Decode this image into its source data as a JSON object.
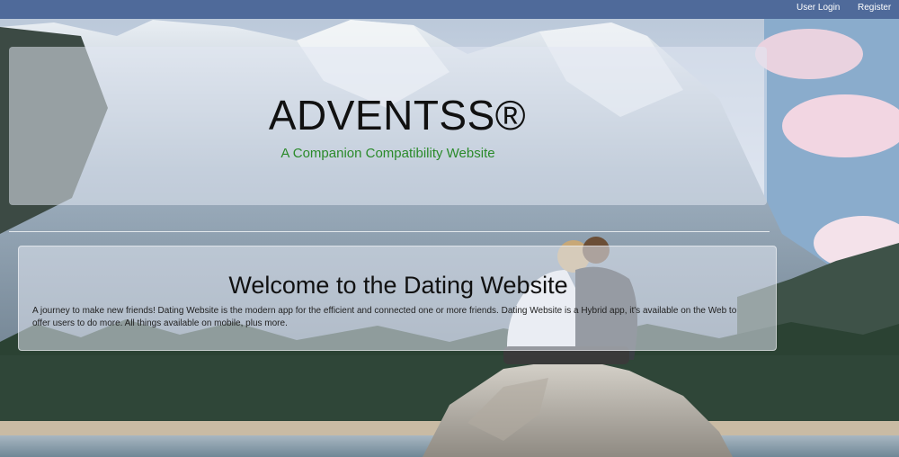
{
  "nav": {
    "login_label": "User Login",
    "register_label": "Register"
  },
  "hero": {
    "title": "ADVENTSS®",
    "subtitle": "A Companion Compatibility Website"
  },
  "welcome": {
    "title": "Welcome to the Dating Website",
    "body": "A journey to make new friends! Dating Website is the modern app for the efficient and connected one or more friends. Dating Website is a Hybrid app, it's available on the Web to offer users to do more. All things available on mobile, plus more."
  },
  "colors": {
    "navbar": "#4f6a9a",
    "subtitle": "#2a8a2a",
    "panel": "rgba(225,232,242,0.55)"
  }
}
